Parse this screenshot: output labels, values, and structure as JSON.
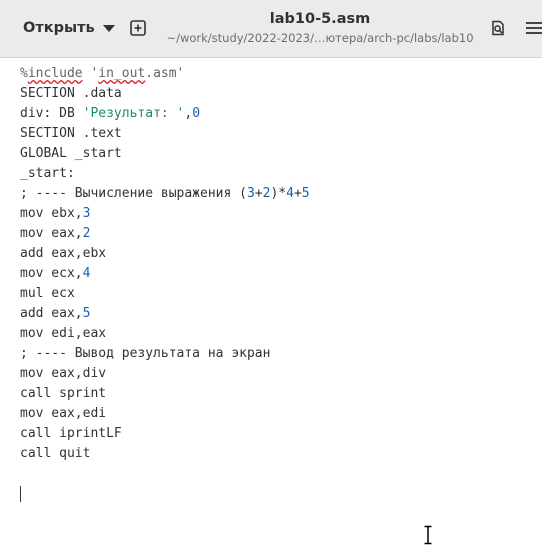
{
  "toolbar": {
    "open_label": "Открыть",
    "title": "lab10-5.asm",
    "subtitle": "~/work/study/2022-2023/…ютера/arch-pc/labs/lab10"
  },
  "icons": {
    "open_menu": "chevron-down-icon",
    "new_tab": "new-tab-plus-icon",
    "search": "search-document-icon",
    "main_menu": "hamburger-menu-icon"
  },
  "colors": {
    "header_bg": "#ebebeb",
    "text": "#2e3436",
    "string": "#1c8a63",
    "number": "#1a5fb4",
    "spell_error": "#e01b24"
  },
  "code": {
    "l1_a": "%",
    "l1_b": "include",
    "l1_c": " '",
    "l1_d": "in_out",
    "l1_e": ".asm'",
    "l2": "SECTION .data",
    "l3_a": "div: DB ",
    "l3_b": "'Результат: '",
    "l3_c": ",",
    "l3_d": "0",
    "l4": "SECTION .text",
    "l5": "GLOBAL _start",
    "l6": "_start:",
    "l7_a": "; ---- Вычисление выражения (",
    "l7_b": "3",
    "l7_c": "+",
    "l7_d": "2",
    "l7_e": ")*",
    "l7_f": "4",
    "l7_g": "+",
    "l7_h": "5",
    "l8_a": "mov ebx,",
    "l8_b": "3",
    "l9_a": "mov eax,",
    "l9_b": "2",
    "l10": "add eax,ebx",
    "l11_a": "mov ecx,",
    "l11_b": "4",
    "l12": "mul ecx",
    "l13_a": "add eax,",
    "l13_b": "5",
    "l14": "mov edi,eax",
    "l15": "; ---- Вывод результата на экран",
    "l16": "mov eax,div",
    "l17": "call sprint",
    "l18": "mov eax,edi",
    "l19": "call iprintLF",
    "l20": "call quit"
  }
}
